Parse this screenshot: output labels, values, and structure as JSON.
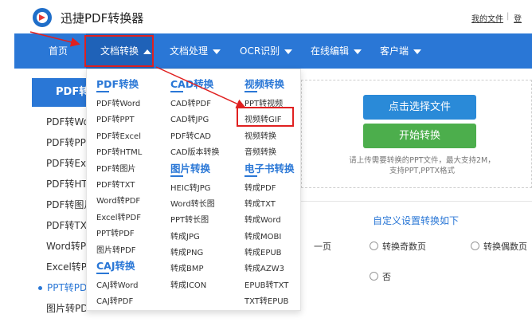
{
  "header": {
    "app_title": "迅捷PDF转换器",
    "my_files": "我的文件",
    "separator": "|",
    "more": "登"
  },
  "nav": {
    "items": [
      {
        "label": "首页",
        "has_caret": false
      },
      {
        "label": "文档转换",
        "has_caret": true,
        "active": true
      },
      {
        "label": "文档处理",
        "has_caret": true
      },
      {
        "label": "OCR识别",
        "has_caret": true
      },
      {
        "label": "在线编辑",
        "has_caret": true
      },
      {
        "label": "客户端",
        "has_caret": true
      }
    ]
  },
  "dropdown": {
    "pdf": {
      "heading": "PDF转换",
      "links": [
        "PDF转Word",
        "PDF转PPT",
        "PDF转Excel",
        "PDF转HTML",
        "PDF转图片",
        "PDF转TXT",
        "Word转PDF",
        "Excel转PDF",
        "PPT转PDF",
        "图片转PDF"
      ]
    },
    "caj": {
      "heading": "CAJ转换",
      "links": [
        "CAJ转Word",
        "CAJ转PDF"
      ]
    },
    "cad": {
      "heading": "CAD转换",
      "links": [
        "CAD转PDF",
        "CAD转JPG",
        "PDF转CAD",
        "CAD版本转换"
      ]
    },
    "image": {
      "heading": "图片转换",
      "links": [
        "HEIC转JPG",
        "Word转长图",
        "PPT转长图",
        "转成JPG",
        "转成PNG",
        "转成BMP",
        "转成ICON"
      ]
    },
    "video": {
      "heading": "视频转换",
      "links": [
        "PPT转视频",
        "视频转GIF",
        "视频转换",
        "音频转换"
      ]
    },
    "ebook": {
      "heading": "电子书转换",
      "links": [
        "转成PDF",
        "转成TXT",
        "转成Word",
        "转成MOBI",
        "转成EPUB",
        "转成AZW3",
        "EPUB转TXT",
        "TXT转EPUB"
      ]
    }
  },
  "sidebar": {
    "title": "PDF转",
    "items": [
      {
        "label": "PDF转Wo",
        "active": false
      },
      {
        "label": "PDF转PP",
        "active": false
      },
      {
        "label": "PDF转Exc",
        "active": false
      },
      {
        "label": "PDF转HT",
        "active": false
      },
      {
        "label": "PDF转图片",
        "active": false
      },
      {
        "label": "PDF转TX",
        "active": false
      },
      {
        "label": "Word转P",
        "active": false
      },
      {
        "label": "Excel转P",
        "active": false
      },
      {
        "label": "PPT转PD",
        "active": true
      },
      {
        "label": "图片转PD",
        "active": false
      }
    ]
  },
  "main": {
    "choose_button": "点击选择文件",
    "start_button": "开始转换",
    "hint_line1": "请上传需要转换的PPT文件，最大支持2M，",
    "hint_line2": "支持PPT,PPTX格式",
    "settings_title": "自定义设置转换如下",
    "left_option_fragment": "一页",
    "options": {
      "odd": "转换奇数页",
      "even": "转换偶数页",
      "no": "否"
    }
  },
  "colors": {
    "nav_blue": "#2a77d6",
    "green": "#4cae4c",
    "highlight_red": "#e02020"
  }
}
